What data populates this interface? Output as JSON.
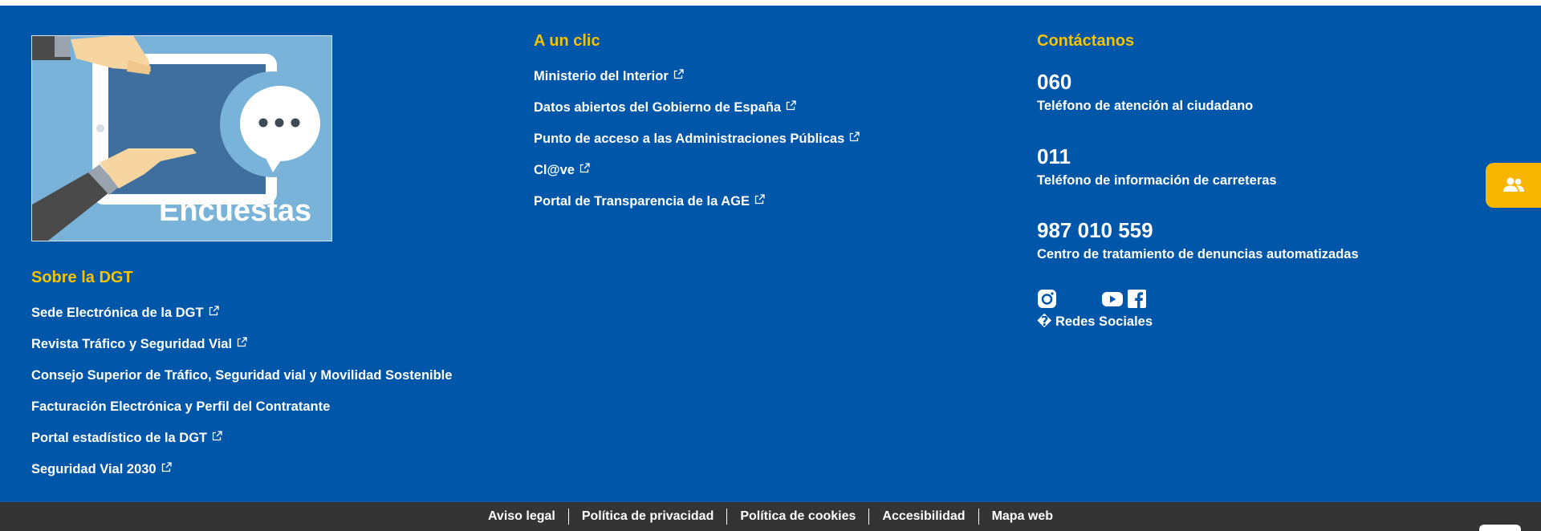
{
  "survey_banner": {
    "text": "Encuestas"
  },
  "sobre": {
    "heading": "Sobre la DGT",
    "links": [
      {
        "label": "Sede Electrónica de la DGT",
        "external": true
      },
      {
        "label": "Revista Tráfico y Seguridad Vial",
        "external": true
      },
      {
        "label": "Consejo Superior de Tráfico, Seguridad vial y Movilidad Sostenible",
        "external": false
      },
      {
        "label": "Facturación Electrónica y Perfil del Contratante",
        "external": false
      },
      {
        "label": "Portal estadístico de la DGT",
        "external": true
      },
      {
        "label": "Seguridad Vial 2030",
        "external": true
      }
    ]
  },
  "a_un_clic": {
    "heading": "A un clic",
    "links": [
      {
        "label": "Ministerio del Interior",
        "external": true
      },
      {
        "label": "Datos abiertos del Gobierno de España",
        "external": true
      },
      {
        "label": "Punto de acceso a las Administraciones Públicas",
        "external": true
      },
      {
        "label": "Cl@ve",
        "external": true
      },
      {
        "label": "Portal de Transparencia de la AGE",
        "external": true
      }
    ]
  },
  "contacto": {
    "heading": "Contáctanos",
    "phones": [
      {
        "number": "060",
        "description": "Teléfono de atención al ciudadano"
      },
      {
        "number": "011",
        "description": "Teléfono de información de carreteras"
      },
      {
        "number": "987 010 559",
        "description": "Centro de tratamiento de denuncias automatizadas"
      }
    ],
    "social": {
      "icons": [
        "instagram-icon",
        "twitter-icon",
        "youtube-icon",
        "facebook-icon"
      ],
      "label": "� Redes Sociales"
    }
  },
  "floating_button": {
    "icon": "users-icon"
  },
  "bottom_bar": {
    "links": [
      "Aviso legal",
      "Política de privacidad",
      "Política de cookies",
      "Accesibilidad",
      "Mapa web"
    ]
  },
  "colors": {
    "footer_bg": "#0057a9",
    "heading_yellow": "#f7c200",
    "bottom_bar_bg": "#343434",
    "floating_btn": "#f7b500"
  }
}
